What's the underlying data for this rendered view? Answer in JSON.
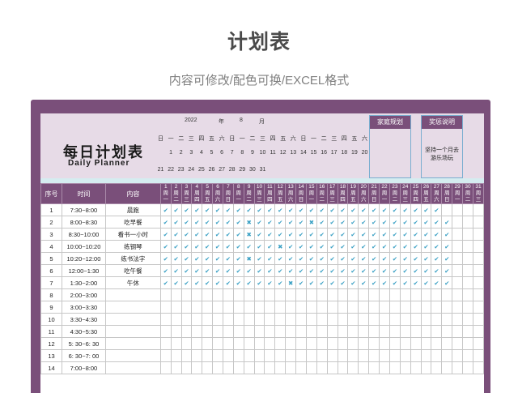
{
  "title": "计划表",
  "subtitle": "内容可修改/配色可换/EXCEL格式",
  "planner": {
    "title": "每日计划表",
    "title_en": "Daily Planner",
    "year": "2022",
    "year_unit": "年",
    "month": "8",
    "month_unit": "月"
  },
  "calendar": {
    "weekdays": [
      "日",
      "一",
      "二",
      "三",
      "四",
      "五",
      "六",
      "日",
      "一",
      "二",
      "三",
      "四",
      "五",
      "六",
      "日",
      "一",
      "二",
      "三",
      "四",
      "五",
      "六"
    ],
    "row1": [
      "",
      "1",
      "2",
      "3",
      "4",
      "5",
      "6",
      "7",
      "8",
      "9",
      "10",
      "11",
      "12",
      "13",
      "14",
      "15",
      "16",
      "17",
      "18",
      "19",
      "20"
    ],
    "row2": [
      "21",
      "22",
      "23",
      "24",
      "25",
      "26",
      "27",
      "28",
      "29",
      "30",
      "31",
      "",
      "",
      "",
      "",
      "",
      "",
      "",
      "",
      "",
      ""
    ]
  },
  "family_plan": {
    "label": "家庭规划",
    "text": ""
  },
  "reward": {
    "label": "奖惩说明",
    "text_line1": "坚持一个月去",
    "text_line2": "游乐场玩"
  },
  "table": {
    "col_no": "序号",
    "col_time": "时间",
    "col_content": "内容",
    "days": [
      "1",
      "2",
      "3",
      "4",
      "5",
      "6",
      "7",
      "8",
      "9",
      "10",
      "11",
      "12",
      "13",
      "14",
      "15",
      "16",
      "17",
      "18",
      "19",
      "20",
      "21",
      "22",
      "23",
      "24",
      "25",
      "26",
      "27",
      "28",
      "29",
      "30",
      "31"
    ],
    "day_weekday_labels": [
      "周一",
      "周二",
      "周三",
      "周四",
      "周五",
      "周六",
      "周日",
      "周一",
      "周二",
      "周三",
      "周四",
      "周五",
      "周六",
      "周日",
      "周一",
      "周二",
      "周三",
      "周四",
      "周五",
      "周六",
      "周日",
      "周一",
      "周二",
      "周三",
      "周四",
      "周五",
      "周六",
      "周日",
      "周一",
      "周二",
      "周三"
    ],
    "rows": [
      {
        "no": "1",
        "time": "7:30~8:00",
        "content": "晨跑",
        "marks": "vvvvvvvvvvvvvvvvvvvvvvvvvvv----"
      },
      {
        "no": "2",
        "time": "8:00~8:30",
        "content": "吃早餐",
        "marks": "vvvvvvvvxvvvvvxvvvvvvvvvvvvv---"
      },
      {
        "no": "3",
        "time": "8:30~10:00",
        "content": "看书一小时",
        "marks": "vvvvvvvvxvvvvvvvvvvvvvvvvvvv---"
      },
      {
        "no": "4",
        "time": "10:00~10:20",
        "content": "练钢琴",
        "marks": "vvvvvvvvvvvxvvvvvvvvvvvvvvvv---"
      },
      {
        "no": "5",
        "time": "10:20~12:00",
        "content": "练书法字",
        "marks": "vvvvvvvvxvvvvvvvvvvvvvvvvvvv---"
      },
      {
        "no": "6",
        "time": "12:00~1:30",
        "content": "吃午餐",
        "marks": "vvvvvvvvvvvvvvvvvvvvvvvvvvvv---"
      },
      {
        "no": "7",
        "time": "1:30~2:00",
        "content": "午休",
        "marks": "vvvvvvvvvvvvxvvvvvvvvvvvvvvv---"
      },
      {
        "no": "8",
        "time": "2:00~3:00",
        "content": "",
        "marks": ""
      },
      {
        "no": "9",
        "time": "3:00~3:30",
        "content": "",
        "marks": ""
      },
      {
        "no": "10",
        "time": "3:30~4:30",
        "content": "",
        "marks": ""
      },
      {
        "no": "11",
        "time": "4:30~5:30",
        "content": "",
        "marks": ""
      },
      {
        "no": "12",
        "time": "5: 30~6: 30",
        "content": "",
        "marks": ""
      },
      {
        "no": "13",
        "time": "6: 30~7: 00",
        "content": "",
        "marks": ""
      },
      {
        "no": "14",
        "time": "7:00~8:00",
        "content": "",
        "marks": ""
      }
    ]
  },
  "icons": {
    "check": "check-icon",
    "cross": "cross-icon"
  },
  "colors": {
    "frame": "#7a4f7a",
    "header_band": "#e7dbe7",
    "mark": "#3aa0c4"
  }
}
